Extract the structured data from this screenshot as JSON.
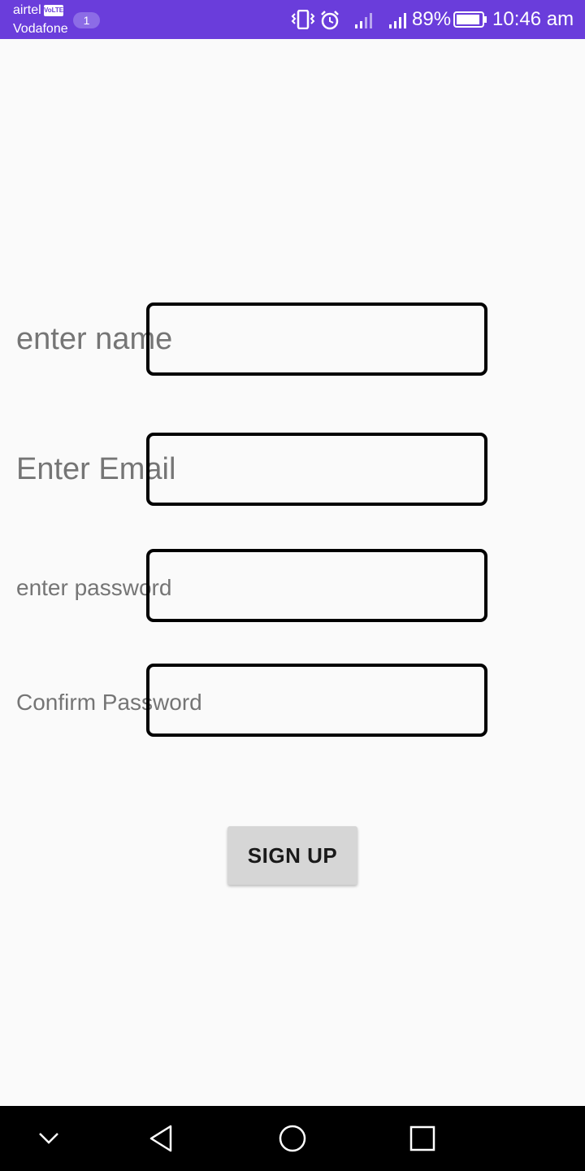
{
  "status_bar": {
    "carrier_primary": "airtel",
    "volte_label": "VoLTE",
    "carrier_secondary": "Vodafone",
    "notification_count": "1",
    "battery_percent": "89%",
    "time": "10:46 am",
    "background_color": "#6a3ddb",
    "icons": [
      "vibrate-icon",
      "alarm-icon",
      "signal-weak-icon",
      "signal-strong-icon",
      "battery-icon"
    ]
  },
  "form": {
    "name_label": "enter name",
    "email_label": "Enter Email",
    "password_label": "enter password",
    "confirm_password_label": "Confirm Password",
    "signup_label": "SIGN UP"
  },
  "nav_bar": {
    "icons": [
      "chevron-down-icon",
      "back-icon",
      "home-icon",
      "recents-icon"
    ]
  }
}
